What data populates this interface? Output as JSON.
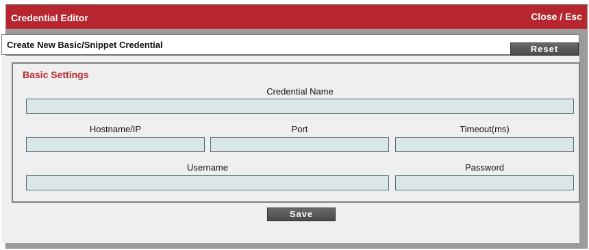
{
  "window": {
    "title": "Credential Editor",
    "close_label": "Close / Esc"
  },
  "header": {
    "title": "Create New Basic/Snippet Credential",
    "reset_label": "Reset"
  },
  "basic_settings": {
    "legend": "Basic Settings",
    "credential_name": {
      "label": "Credential Name",
      "value": ""
    },
    "hostname": {
      "label": "Hostname/IP",
      "value": ""
    },
    "port": {
      "label": "Port",
      "value": ""
    },
    "timeout": {
      "label": "Timeout(ms)",
      "value": ""
    },
    "username": {
      "label": "Username",
      "value": ""
    },
    "password": {
      "label": "Password",
      "value": ""
    }
  },
  "footer": {
    "save_label": "Save"
  },
  "colors": {
    "accent": "#b7262e",
    "field_bg": "#dbe7e7",
    "field_border": "#4c6e6e",
    "button_bg": "#555555",
    "panel_bg": "#efefef"
  }
}
